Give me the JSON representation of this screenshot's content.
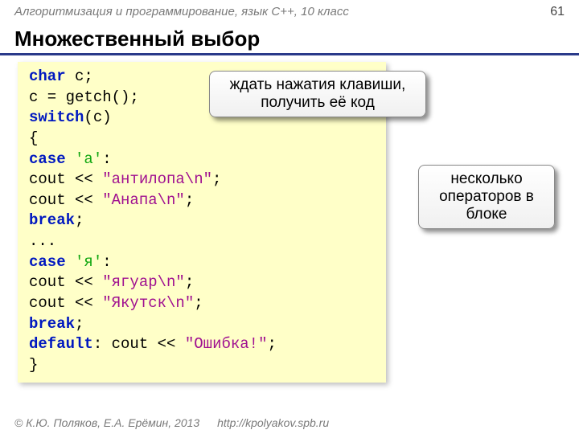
{
  "header": {
    "subtitle": "Алгоритмизация и программирование, язык  C++, 10 класс",
    "page_number": "61"
  },
  "title": "Множественный выбор",
  "code": {
    "l1a": "char",
    "l1b": " c;",
    "l2a": "c = ",
    "l2b": "getch",
    "l2c": "();",
    "l3a": "switch",
    "l3b": "(c)",
    "l4": "  {",
    "l5a": "  case",
    "l5b": " 'а'",
    "l5c": ":",
    "l6a": "     cout << ",
    "l6b": "\"антилопа\\n\"",
    "l6c": ";",
    "l7a": "     cout << ",
    "l7b": "\"Анапа\\n\"",
    "l7c": ";",
    "l8a": "     break",
    "l8b": ";",
    "l9": "  ...",
    "l10a": "  case",
    "l10b": " 'я'",
    "l10c": ":",
    "l11a": "     cout << ",
    "l11b": "\"ягуар\\n\"",
    "l11c": ";",
    "l12a": "     cout << ",
    "l12b": "\"Якутск\\n\"",
    "l12c": ";",
    "l13a": "     break",
    "l13b": ";",
    "l14a": "  default",
    "l14b": ": cout << ",
    "l14c": "\"Ошибка!\"",
    "l14d": ";",
    "l15": "  }"
  },
  "callouts": {
    "c1": "ждать нажатия клавиши, получить её код",
    "c2": "несколько операторов в блоке"
  },
  "footer": {
    "copyright": "© К.Ю. Поляков, Е.А. Ерёмин, 2013",
    "url": "http://kpolyakov.spb.ru"
  }
}
